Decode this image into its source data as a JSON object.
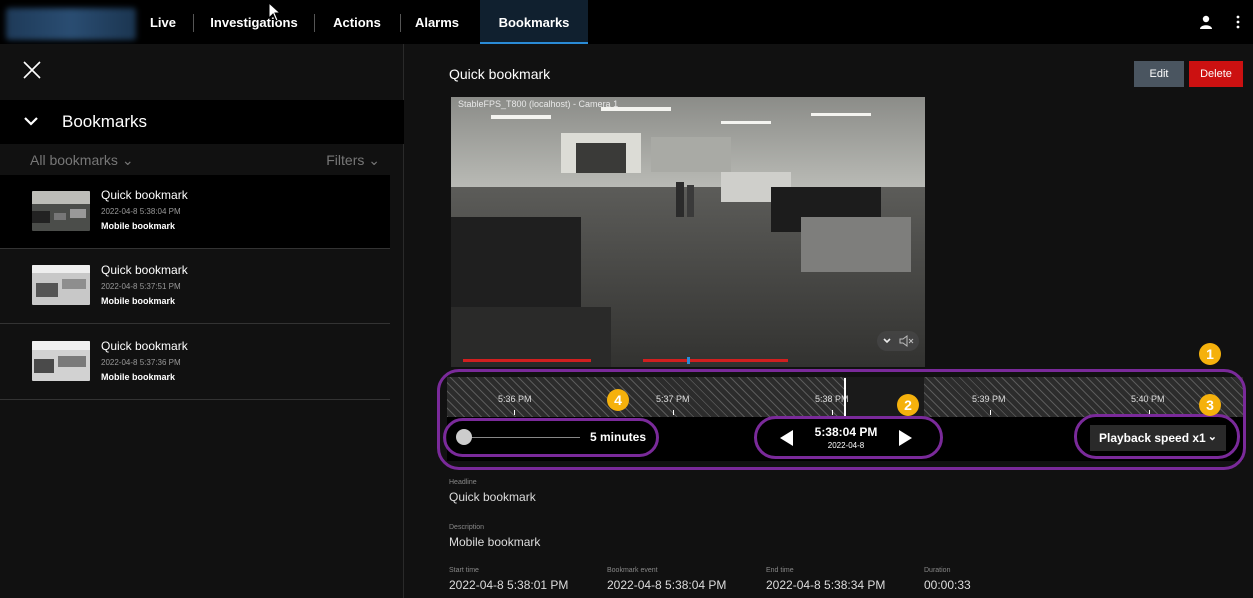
{
  "nav": {
    "tabs": [
      {
        "label": "Live"
      },
      {
        "label": "Investigations"
      },
      {
        "label": "Actions"
      },
      {
        "label": "Alarms"
      },
      {
        "label": "Bookmarks"
      }
    ]
  },
  "sidebar": {
    "title": "Bookmarks",
    "all_label": "All bookmarks",
    "filters_label": "Filters",
    "items": [
      {
        "title": "Quick bookmark",
        "time": "2022-04-8 5:38:04 PM",
        "desc": "Mobile bookmark"
      },
      {
        "title": "Quick bookmark",
        "time": "2022-04-8 5:37:51 PM",
        "desc": "Mobile bookmark"
      },
      {
        "title": "Quick bookmark",
        "time": "2022-04-8 5:37:36 PM",
        "desc": "Mobile bookmark"
      }
    ]
  },
  "detail": {
    "title": "Quick bookmark",
    "edit_label": "Edit",
    "delete_label": "Delete",
    "camera_label": "StableFPS_T800 (localhost) - Camera 1"
  },
  "timeline": {
    "ticks": [
      "5:36 PM",
      "5:37 PM",
      "5:38 PM",
      "5:39 PM",
      "5:40 PM"
    ],
    "zoom_label": "5 minutes",
    "current_time": "5:38:04 PM",
    "current_date": "2022-04-8",
    "speed_label": "Playback speed x1"
  },
  "badges": [
    "1",
    "2",
    "3",
    "4"
  ],
  "fields": {
    "headline_label": "Headline",
    "headline_value": "Quick bookmark",
    "description_label": "Description",
    "description_value": "Mobile bookmark",
    "start_label": "Start time",
    "start_value": "2022-04-8 5:38:01 PM",
    "event_label": "Bookmark event",
    "event_value": "2022-04-8 5:38:04 PM",
    "end_label": "End time",
    "end_value": "2022-04-8 5:38:34 PM",
    "duration_label": "Duration",
    "duration_value": "00:00:33"
  },
  "colors": {
    "accent": "#2a8bd6",
    "delete": "#cc1111",
    "annotation_ring": "#7a2a9a",
    "annotation_badge": "#f5b10c"
  }
}
